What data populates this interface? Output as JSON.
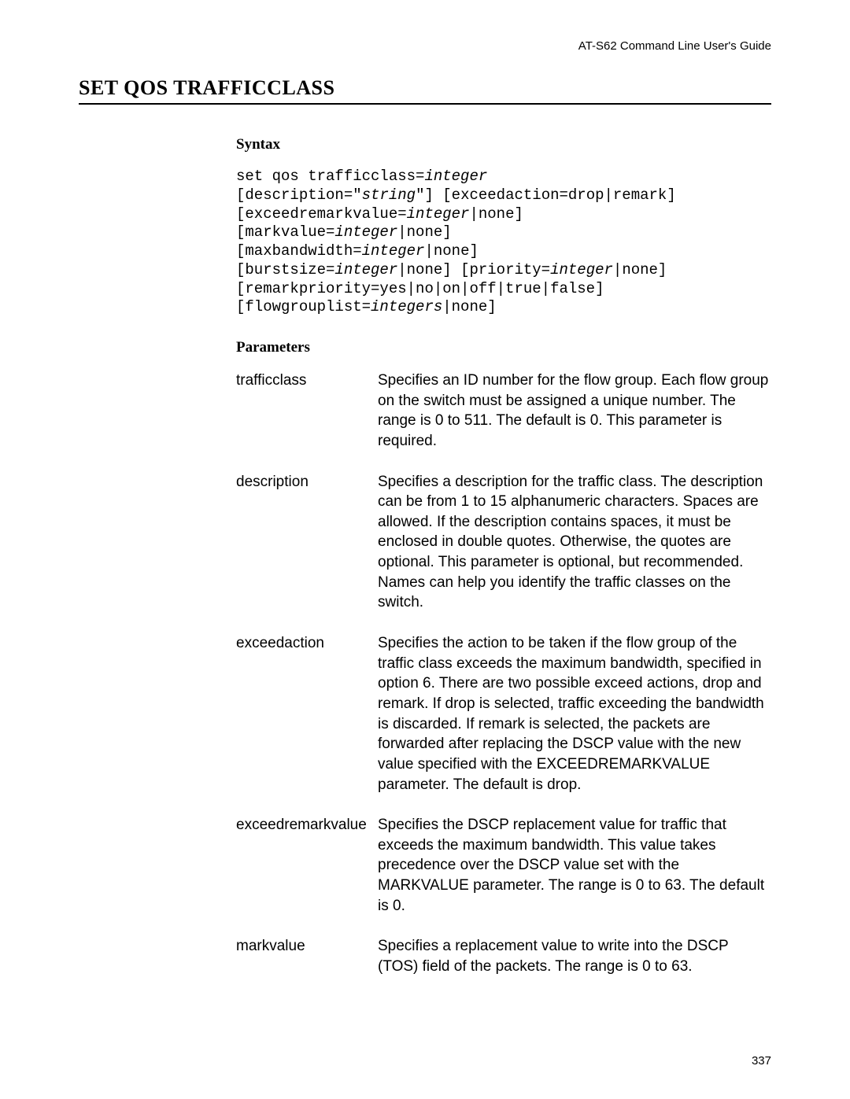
{
  "header": {
    "guide": "AT-S62 Command Line User's Guide"
  },
  "title": "SET QOS TRAFFICCLASS",
  "sections": {
    "syntax_heading": "Syntax",
    "parameters_heading": "Parameters"
  },
  "syntax": {
    "l1a": "set qos trafficclass=",
    "l1b": "integer",
    "l2a": "[description=\"",
    "l2b": "string",
    "l2c": "\"] [exceedaction=drop|remark]",
    "l3a": "[exceedremarkvalue=",
    "l3b": "integer",
    "l3c": "|none]",
    "l4a": "[markvalue=",
    "l4b": "integer",
    "l4c": "|none]",
    "l5a": "[maxbandwidth=",
    "l5b": "integer",
    "l5c": "|none]",
    "l6a": "[burstsize=",
    "l6b": "integer",
    "l6c": "|none] [priority=",
    "l6d": "integer",
    "l6e": "|none]",
    "l7a": "[remarkpriority=yes|no|on|off|true|false]",
    "l8a": "[flowgrouplist=",
    "l8b": "integers",
    "l8c": "|none]"
  },
  "parameters": [
    {
      "name": "trafficclass",
      "desc": "Specifies an ID number for the flow group. Each flow group on the switch must be assigned a unique number. The range is 0 to 511. The default is 0. This parameter is required."
    },
    {
      "name": "description",
      "desc": "Specifies a description for the traffic class. The description can be from 1 to 15 alphanumeric characters. Spaces are allowed. If the description contains spaces, it must be enclosed in double quotes. Otherwise, the quotes are optional. This parameter is optional, but recommended. Names can help you identify the traffic classes on the switch."
    },
    {
      "name": "exceedaction",
      "desc": "Specifies the action to be taken if the flow group of the traffic class exceeds the maximum bandwidth, specified in option 6. There are two possible exceed actions, drop and remark. If drop is selected, traffic exceeding the bandwidth is discarded. If remark is selected, the packets are forwarded after replacing the DSCP value with the new value specified with the EXCEEDREMARKVALUE parameter. The default is drop."
    },
    {
      "name": "exceedremarkvalue",
      "desc": "Specifies the DSCP replacement value for traffic that exceeds the maximum bandwidth. This value takes precedence over the DSCP value set with the MARKVALUE parameter. The range is 0 to 63. The default is 0."
    },
    {
      "name": "markvalue",
      "desc": "Specifies a replacement value to write into the DSCP (TOS) field of the packets. The range is 0 to 63."
    }
  ],
  "page_number": "337"
}
